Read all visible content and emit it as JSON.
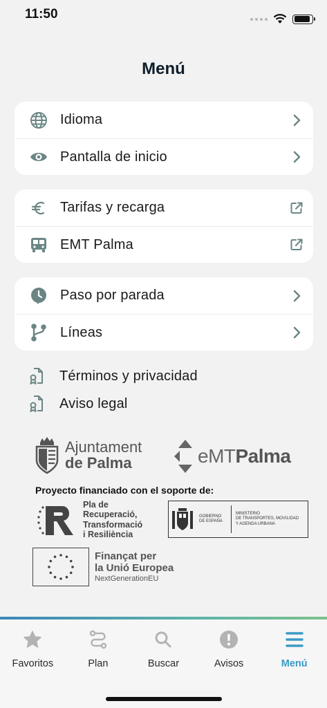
{
  "status": {
    "time": "11:50"
  },
  "title": "Menú",
  "groups": [
    {
      "items": [
        {
          "label": "Idioma",
          "icon": "globe-icon",
          "trail": "chevron-right-icon"
        },
        {
          "label": "Pantalla de inicio",
          "icon": "eye-icon",
          "trail": "chevron-right-icon"
        }
      ]
    },
    {
      "items": [
        {
          "label": "Tarifas y recarga",
          "icon": "euro-icon",
          "trail": "external-link-icon"
        },
        {
          "label": "EMT Palma",
          "icon": "bus-icon",
          "trail": "external-link-icon"
        }
      ]
    },
    {
      "items": [
        {
          "label": "Paso por parada",
          "icon": "clock-icon",
          "trail": "chevron-right-icon"
        },
        {
          "label": "Líneas",
          "icon": "route-icon",
          "trail": "chevron-right-icon"
        }
      ]
    }
  ],
  "links": [
    {
      "label": "Términos y privacidad",
      "icon": "document-badge-icon"
    },
    {
      "label": "Aviso legal",
      "icon": "document-badge-icon"
    }
  ],
  "logos": {
    "ajuntament_line1": "Ajuntament",
    "ajuntament_line2": "de Palma",
    "emt_prefix": "eMT",
    "emt_suffix": "Palma",
    "funded_by": "Proyecto financiado con el soporte de:",
    "recup_line1": "Pla de",
    "recup_line2": "Recuperació,",
    "recup_line3": "Transformació",
    "recup_line4": "i Resiliència",
    "gob_line1": "GOBIERNO",
    "gob_line2": "DE ESPAÑA",
    "min_line1": "MINISTERIO",
    "min_line2": "DE TRANSPORTES, MOVILIDAD",
    "min_line3": "Y AGENDA URBANA",
    "eu_line1": "Finançat per",
    "eu_line2": "la Unió Europea",
    "eu_line3": "NextGenerationEU"
  },
  "tabs": [
    {
      "label": "Favoritos",
      "icon": "star-icon",
      "active": false
    },
    {
      "label": "Plan",
      "icon": "route-plan-icon",
      "active": false
    },
    {
      "label": "Buscar",
      "icon": "search-icon",
      "active": false
    },
    {
      "label": "Avisos",
      "icon": "alert-icon",
      "active": false
    },
    {
      "label": "Menú",
      "icon": "menu-icon",
      "active": true
    }
  ],
  "colors": {
    "icon": "#6b8585",
    "accent": "#3a9bc6",
    "tab_inactive": "#b3b3b3"
  }
}
